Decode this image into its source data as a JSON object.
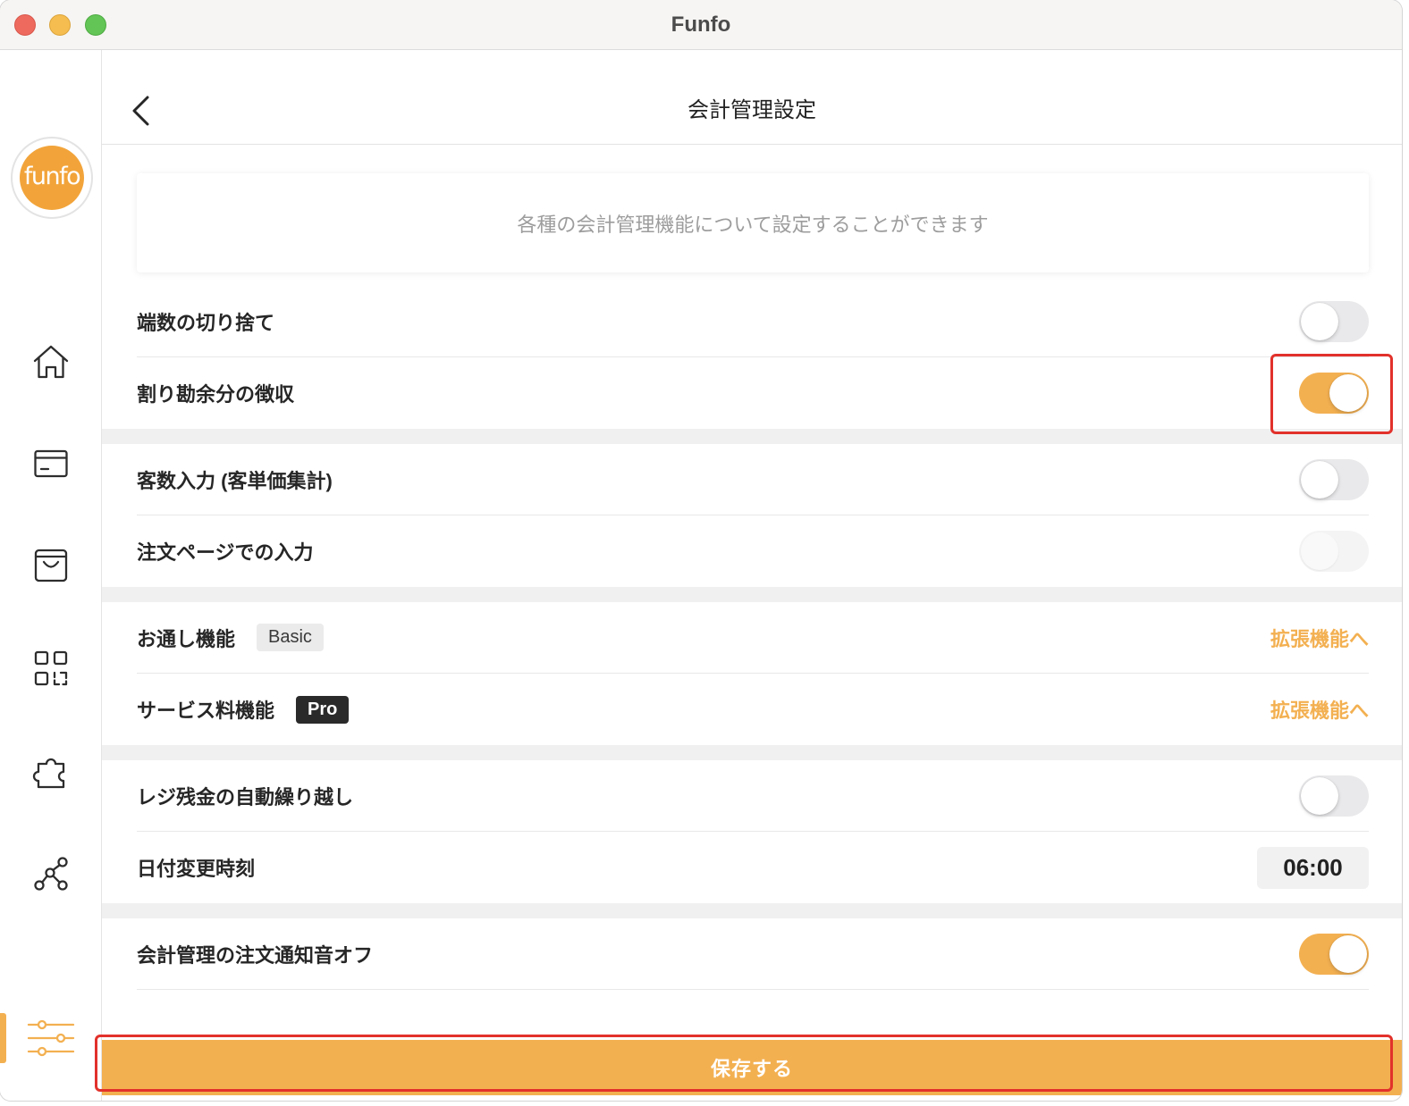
{
  "window": {
    "title": "Funfo"
  },
  "sidebar": {
    "logo_text": "funfo",
    "items": [
      {
        "icon": "home-icon",
        "active": false
      },
      {
        "icon": "card-icon",
        "active": false
      },
      {
        "icon": "shopping-bag-icon",
        "active": false
      },
      {
        "icon": "qr-code-icon",
        "active": false
      },
      {
        "icon": "puzzle-icon",
        "active": false
      },
      {
        "icon": "network-icon",
        "active": false
      },
      {
        "icon": "settings-sliders-icon",
        "active": true
      }
    ]
  },
  "header": {
    "title": "会計管理設定",
    "back_icon": "chevron-left-icon"
  },
  "info_card": {
    "text": "各種の会計管理機能について設定することができます"
  },
  "sections": [
    {
      "rows": [
        {
          "label": "端数の切り捨て",
          "toggle_on": false
        },
        {
          "label": "割り勘余分の徴収",
          "toggle_on": true
        }
      ]
    },
    {
      "rows": [
        {
          "label": "客数入力 (客単価集計)",
          "toggle_on": false
        },
        {
          "label": "注文ページでの入力",
          "toggle_on": false,
          "toggle_disabled": true
        }
      ]
    },
    {
      "rows": [
        {
          "label": "お通し機能",
          "badge": {
            "text": "Basic",
            "style": "light"
          },
          "link": "拡張機能へ"
        },
        {
          "label": "サービス料機能",
          "badge": {
            "text": "Pro",
            "style": "dark"
          },
          "link": "拡張機能へ"
        }
      ]
    },
    {
      "rows": [
        {
          "label": "レジ残金の自動繰り越し",
          "toggle_on": false
        },
        {
          "label": "日付変更時刻",
          "time": "06:00"
        }
      ]
    },
    {
      "rows": [
        {
          "label": "会計管理の注文通知音オフ",
          "toggle_on": true
        }
      ]
    }
  ],
  "save_button": {
    "label": "保存する"
  },
  "colors": {
    "accent": "#F3B051",
    "annotation": "#E2312B",
    "logo": "#F2A43A"
  }
}
